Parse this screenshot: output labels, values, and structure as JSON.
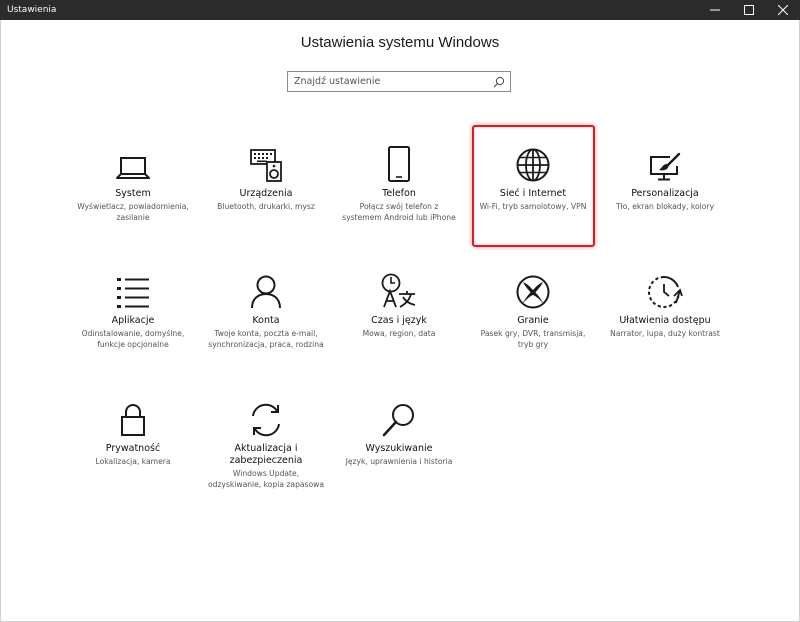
{
  "window": {
    "title": "Ustawienia",
    "controls": {
      "minimize": "minimize-icon",
      "maximize": "maximize-icon",
      "close": "close-icon"
    }
  },
  "header": {
    "title": "Ustawienia systemu Windows"
  },
  "search": {
    "placeholder": "Znajdź ustawienie",
    "icon": "search-icon"
  },
  "accent": {
    "highlight": "#c4262e",
    "titlebar": "#2b2b2b"
  },
  "tiles": [
    {
      "id": "system",
      "icon": "laptop-icon",
      "name": "System",
      "desc": "Wyświetlacz, powiadomienia, zasilanie"
    },
    {
      "id": "devices",
      "icon": "keyboard-speaker-icon",
      "name": "Urządzenia",
      "desc": "Bluetooth, drukarki, mysz"
    },
    {
      "id": "phone",
      "icon": "phone-icon",
      "name": "Telefon",
      "desc": "Połącz swój telefon z systemem Android lub iPhone"
    },
    {
      "id": "network",
      "icon": "globe-icon",
      "name": "Sieć i Internet",
      "desc": "Wi-Fi, tryb samolotowy, VPN"
    },
    {
      "id": "personalization",
      "icon": "paint-screen-icon",
      "name": "Personalizacja",
      "desc": "Tło, ekran blokady, kolory"
    },
    {
      "id": "apps",
      "icon": "apps-list-icon",
      "name": "Aplikacje",
      "desc": "Odinstalowanie, domyślne, funkcje opcjonalne"
    },
    {
      "id": "accounts",
      "icon": "person-icon",
      "name": "Konta",
      "desc": "Twoje konta, poczta e-mail, synchronizacja, praca, rodzina"
    },
    {
      "id": "time-language",
      "icon": "clock-language-icon",
      "name": "Czas i język",
      "desc": "Mowa, region, data"
    },
    {
      "id": "gaming",
      "icon": "xbox-icon",
      "name": "Granie",
      "desc": "Pasek gry, DVR, transmisja, tryb gry"
    },
    {
      "id": "ease-of-access",
      "icon": "ease-of-access-icon",
      "name": "Ułatwienia dostępu",
      "desc": "Narrator, lupa, duży kontrast"
    },
    {
      "id": "privacy",
      "icon": "lock-icon",
      "name": "Prywatność",
      "desc": "Lokalizacja, kamera"
    },
    {
      "id": "update-security",
      "icon": "sync-icon",
      "name": "Aktualizacja i zabezpieczenia",
      "desc": "Windows Update, odzyskiwanie, kopia zapasowa"
    },
    {
      "id": "search",
      "icon": "magnifier-icon",
      "name": "Wyszukiwanie",
      "desc": "Język, uprawnienia i historia"
    }
  ]
}
